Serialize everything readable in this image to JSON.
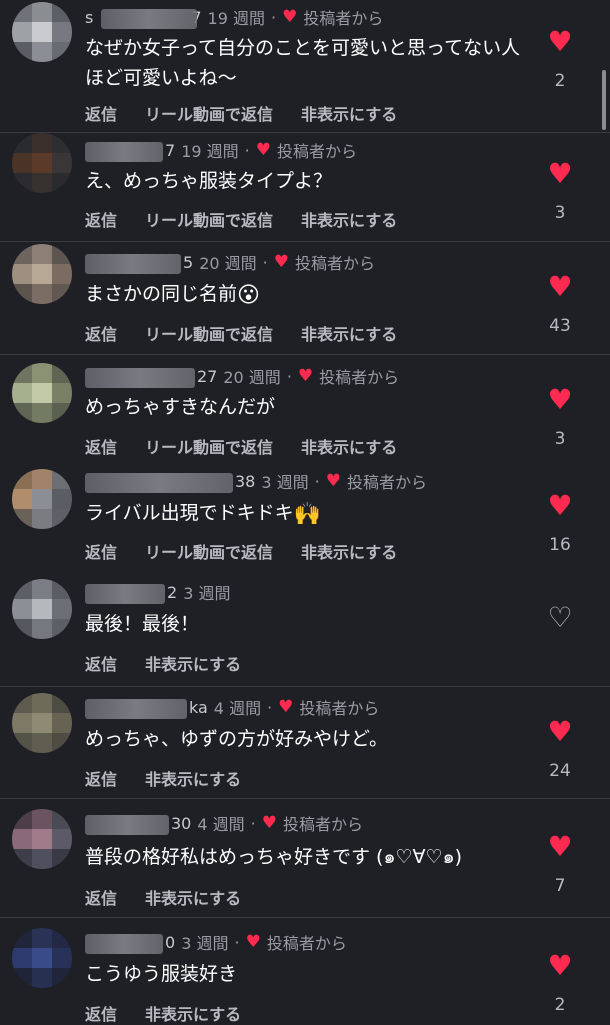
{
  "comments": [
    {
      "user_visible": "s",
      "user_suffix": "7",
      "time": "19 週間",
      "author_liked": "投稿者から",
      "text": "なぜか女子って自分のことを可愛いと思ってない人ほど可愛いよね〜",
      "actions": [
        "返信",
        "リール動画で返信",
        "非表示にする"
      ],
      "likes": "2",
      "liked": true
    },
    {
      "user_visible": "",
      "user_suffix": "7",
      "time": "19 週間",
      "author_liked": "投稿者から",
      "text": "え、めっちゃ服装タイプよ？",
      "actions": [
        "返信",
        "リール動画で返信",
        "非表示にする"
      ],
      "likes": "3",
      "liked": true
    },
    {
      "user_visible": "",
      "user_suffix": "5",
      "time": "20 週間",
      "author_liked": "投稿者から",
      "text": "まさかの同じ名前",
      "emoji": "😮",
      "actions": [
        "返信",
        "リール動画で返信",
        "非表示にする"
      ],
      "likes": "43",
      "liked": true
    },
    {
      "user_visible": "",
      "user_suffix": "27",
      "time": "20 週間",
      "author_liked": "投稿者から",
      "text": "めっちゃすきなんだが",
      "actions": [
        "返信",
        "リール動画で返信",
        "非表示にする"
      ],
      "likes": "3",
      "liked": true
    },
    {
      "user_visible": "",
      "user_suffix": "38",
      "time": "3 週間",
      "author_liked": "投稿者から",
      "text": "ライバル出現でドキドキ",
      "emoji": "🙌",
      "actions": [
        "返信",
        "リール動画で返信",
        "非表示にする"
      ],
      "likes": "16",
      "liked": true
    },
    {
      "user_visible": "",
      "user_suffix": "2",
      "time": "3 週間",
      "author_liked": "",
      "text": "最後！最後！",
      "actions": [
        "返信",
        "非表示にする"
      ],
      "likes": "",
      "liked": false
    },
    {
      "user_visible": "",
      "user_suffix": "ka",
      "time": "4 週間",
      "author_liked": "投稿者から",
      "text": "めっちゃ、ゆずの方が好みやけど。",
      "actions": [
        "返信",
        "非表示にする"
      ],
      "likes": "24",
      "liked": true
    },
    {
      "user_visible": "",
      "user_suffix": "30",
      "time": "4 週間",
      "author_liked": "投稿者から",
      "text": "普段の格好私はめっちゃ好きです (๑♡∀♡๑)",
      "actions": [
        "返信",
        "非表示にする"
      ],
      "likes": "7",
      "liked": true
    },
    {
      "user_visible": "",
      "user_suffix": "0",
      "time": "3 週間",
      "author_liked": "投稿者から",
      "text": "こうゆう服装好き",
      "actions": [
        "返信",
        "非表示にする"
      ],
      "likes": "2",
      "liked": true
    }
  ],
  "icons": {
    "filled_heart": "heart-filled-icon",
    "outline_heart": "heart-outline-icon"
  },
  "colors": {
    "background": "#1f2026",
    "heart": "#ff2a4f",
    "meta": "#9a9ba3"
  }
}
